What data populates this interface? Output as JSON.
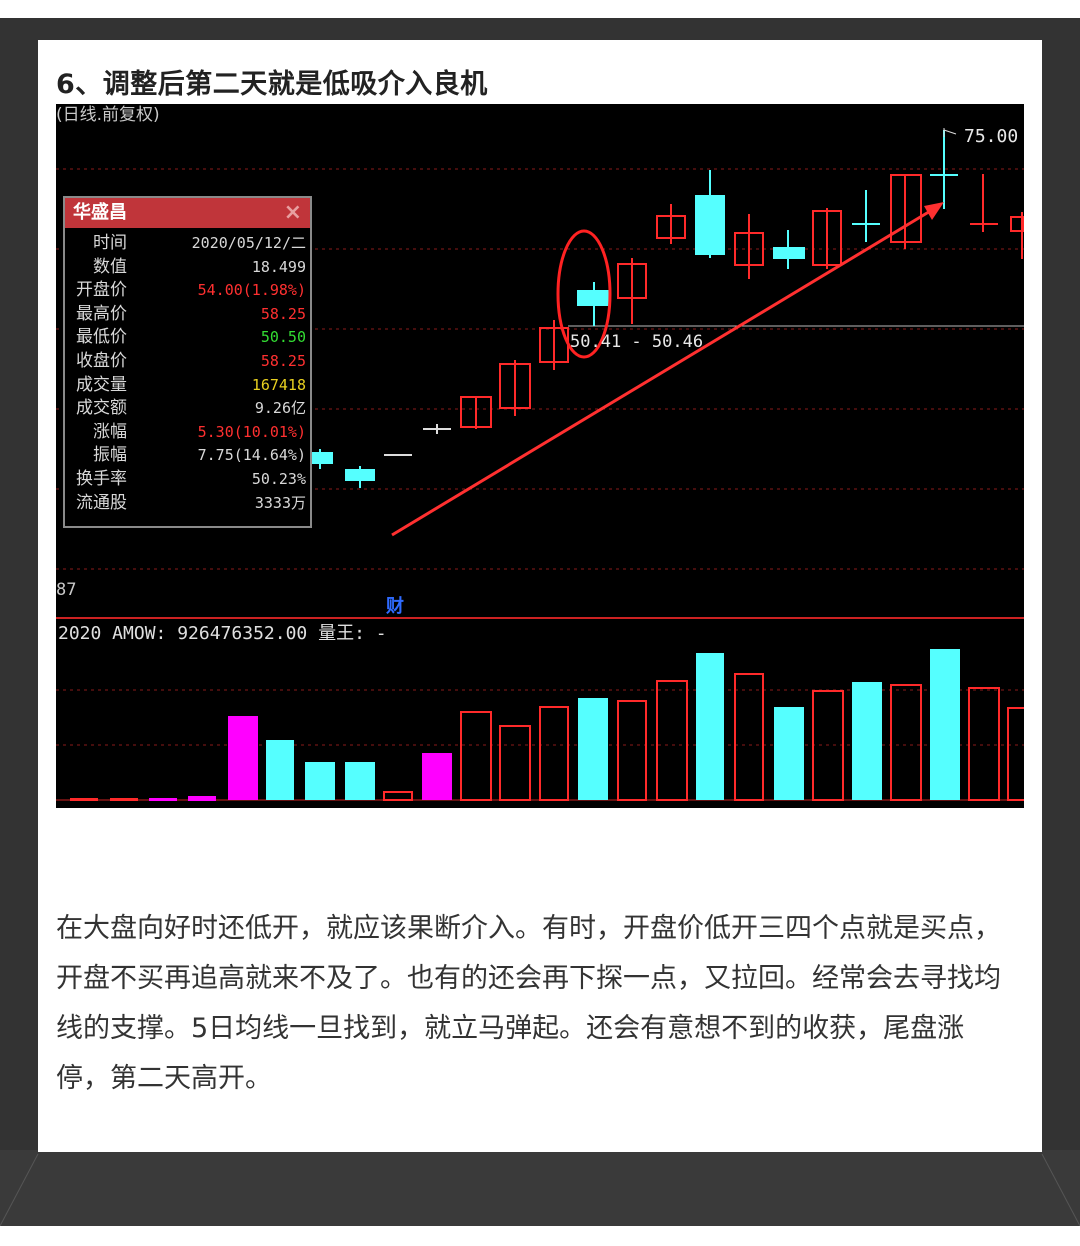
{
  "article": {
    "heading": "6、调整后第二天就是低吸介入良机",
    "paragraph": "在大盘向好时还低开，就应该果断介入。有时，开盘价低开三四个点就是买点，开盘不买再追高就来不及了。也有的还会再下探一点，又拉回。经常会去寻找均线的支撑。5日均线一旦找到，就立马弹起。还会有意想不到的收获，尾盘涨停，第二天高开。"
  },
  "chart": {
    "caption_top": "(日线.前复权)",
    "price_high_label": "75.00",
    "range_label": "50.41 - 50.46",
    "left_mark": "87",
    "finance_marker": "财",
    "volume_title": "2020 AMOW: 926476352.00 量王: -",
    "colors": {
      "up": "#ff2a2a",
      "down": "#55ffff",
      "magenta": "#ff00ff",
      "arrow": "#ff3030"
    }
  },
  "info_panel": {
    "title": "华盛昌",
    "close_icon": "close-icon",
    "rows": [
      {
        "label": "时间",
        "value": "2020/05/12/二",
        "color": "#d8d8d8"
      },
      {
        "label": "数值",
        "value": "18.499",
        "color": "#d8d8d8"
      },
      {
        "label": "开盘价",
        "value": "54.00(1.98%)",
        "color": "#ff3030"
      },
      {
        "label": "最高价",
        "value": "58.25",
        "color": "#ff3030"
      },
      {
        "label": "最低价",
        "value": "50.50",
        "color": "#33dd33"
      },
      {
        "label": "收盘价",
        "value": "58.25",
        "color": "#ff3030"
      },
      {
        "label": "成交量",
        "value": "167418",
        "color": "#e8d020"
      },
      {
        "label": "成交额",
        "value": "9.26亿",
        "color": "#d8d8d8"
      },
      {
        "label": "涨幅",
        "value": "5.30(10.01%)",
        "color": "#ff3030"
      },
      {
        "label": "振幅",
        "value": "7.75(14.64%)",
        "color": "#d8d8d8"
      },
      {
        "label": "换手率",
        "value": "50.23%",
        "color": "#d8d8d8"
      },
      {
        "label": "流通股",
        "value": "3333万",
        "color": "#d8d8d8"
      }
    ]
  }
}
